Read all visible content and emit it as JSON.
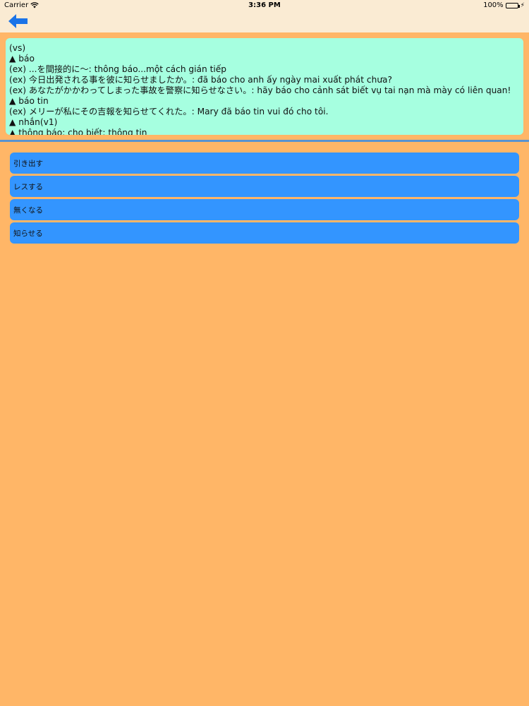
{
  "status_bar": {
    "carrier": "Carrier",
    "time": "3:36 PM",
    "battery": "100%"
  },
  "header": {
    "back_icon": "back-arrow-icon"
  },
  "definition": {
    "lines": [
      "(vs)",
      "▲ báo",
      "(ex) ...を間接的に～: thông báo...một cách gián tiếp",
      "(ex) 今日出発される事を彼に知らせましたか。: đã báo cho anh ấy ngày mai xuất phát chưa?",
      "(ex) あなたがかかわってしまった事故を警察に知らせなさい。: hãy báo cho cảnh sát biết vụ tai nạn mà mày có liên quan!",
      "▲ báo tin",
      "(ex) メリーが私にその吉報を知らせてくれた。: Mary đã báo tin vui đó cho tôi.",
      "▲ nhắn(v1)",
      "▲ thông báo; cho biết; thông tin"
    ]
  },
  "word_list": {
    "items": [
      "引き出す",
      "レスする",
      "無くなる",
      "知らせる"
    ]
  },
  "colors": {
    "background": "#ffb667",
    "header": "#faebd3",
    "definition_box": "#a6ffe0",
    "list_item": "#3395ff",
    "back_arrow": "#1a73e8"
  }
}
